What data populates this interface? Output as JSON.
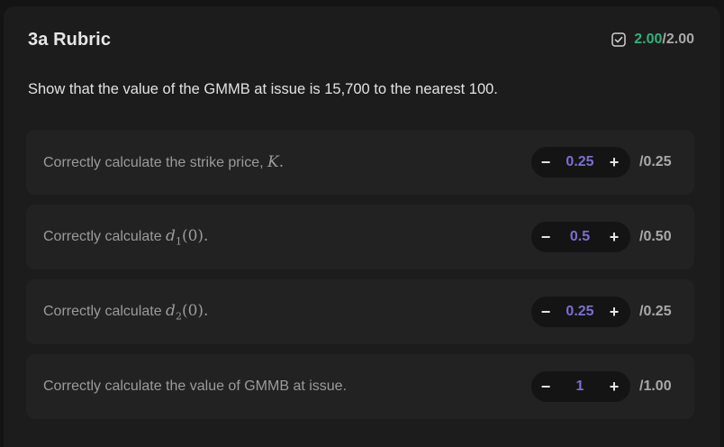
{
  "header": {
    "title": "3a Rubric",
    "score_earned": "2.00",
    "score_total": "/2.00",
    "check_icon": "checkbox-checked-icon",
    "colors": {
      "earned": "#2fb37a",
      "total": "#a9a9a9"
    }
  },
  "question": "Show that the value of the GMMB at issue is 15,700 to the nearest 100.",
  "items": [
    {
      "text": "Correctly calculate the strike price, ",
      "math_var": "K",
      "math_sub": "",
      "math_arg": "",
      "math_after": ".",
      "value": "0.25",
      "max": "/0.25"
    },
    {
      "text": "Correctly calculate ",
      "math_var": "d",
      "math_sub": "1",
      "math_arg": "(0)",
      "math_after": ".",
      "value": "0.5",
      "max": "/0.50"
    },
    {
      "text": "Correctly calculate ",
      "math_var": "d",
      "math_sub": "2",
      "math_arg": "(0)",
      "math_after": ".",
      "value": "0.25",
      "max": "/0.25"
    },
    {
      "text": "Correctly calculate the value of GMMB at issue.",
      "math_var": "",
      "math_sub": "",
      "math_arg": "",
      "math_after": "",
      "value": "1",
      "max": "/1.00"
    }
  ],
  "stepper": {
    "minus": "−",
    "plus": "+",
    "value_color": "#7b6fd0"
  }
}
